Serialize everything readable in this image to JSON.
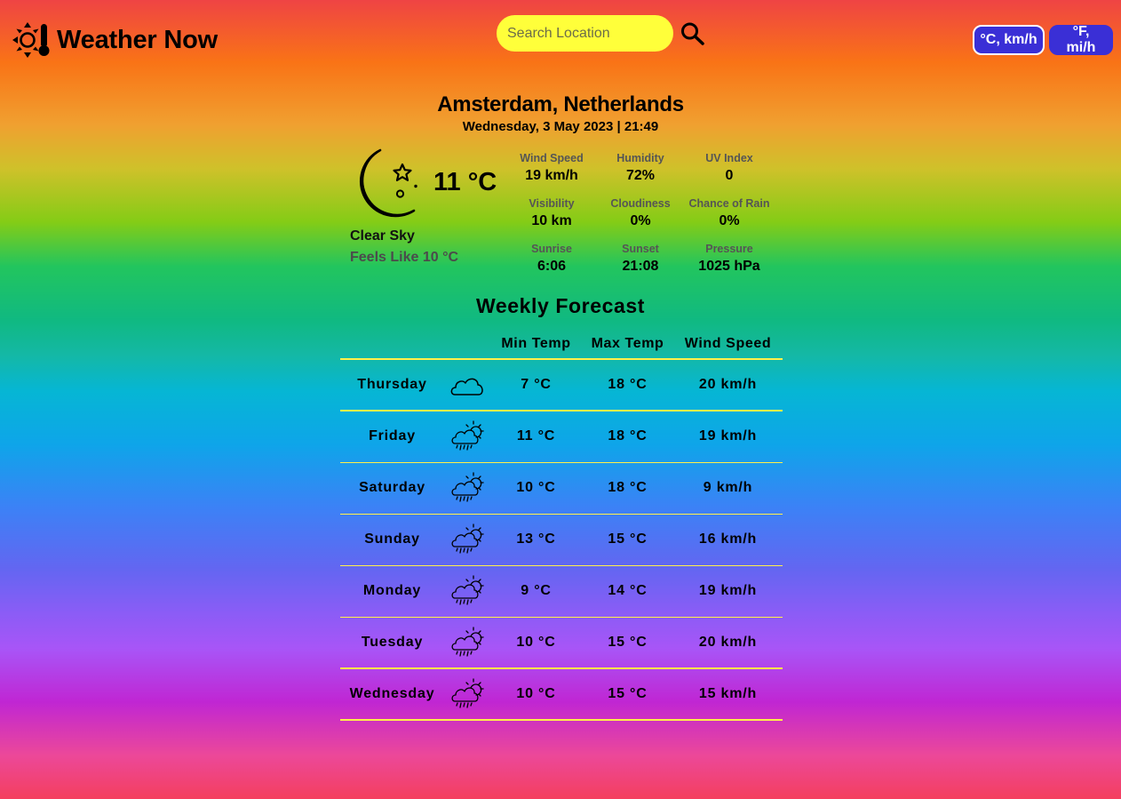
{
  "header": {
    "app_title": "Weather Now",
    "logo_icon": "sun-thermometer-icon",
    "search_placeholder": "Search Location",
    "search_icon": "magnifier-icon",
    "unit_metric_label": "°C, km/h",
    "unit_imperial_label": "°F, mi/h"
  },
  "current": {
    "location": "Amsterdam, Netherlands",
    "datetime": "Wednesday, 3 May 2023 | 21:49",
    "icon": "moon-stars-icon",
    "temperature": "11 °C",
    "condition": "Clear Sky",
    "feels_like": "Feels Like 10 °C",
    "details": [
      {
        "label": "Wind Speed",
        "value": "19 km/h"
      },
      {
        "label": "Humidity",
        "value": "72%"
      },
      {
        "label": "UV Index",
        "value": "0"
      },
      {
        "label": "Visibility",
        "value": "10 km"
      },
      {
        "label": "Cloudiness",
        "value": "0%"
      },
      {
        "label": "Chance of Rain",
        "value": "0%"
      },
      {
        "label": "Sunrise",
        "value": "6:06"
      },
      {
        "label": "Sunset",
        "value": "21:08"
      },
      {
        "label": "Pressure",
        "value": "1025 hPa"
      }
    ]
  },
  "forecast": {
    "title": "Weekly Forecast",
    "columns": [
      "Min Temp",
      "Max Temp",
      "Wind Speed"
    ],
    "days": [
      {
        "day": "Thursday",
        "icon": "cloud-icon",
        "min": "7 °C",
        "max": "18 °C",
        "wind": "20 km/h"
      },
      {
        "day": "Friday",
        "icon": "sun-cloud-rain-icon",
        "min": "11 °C",
        "max": "18 °C",
        "wind": "19 km/h"
      },
      {
        "day": "Saturday",
        "icon": "sun-cloud-rain-icon",
        "min": "10 °C",
        "max": "18 °C",
        "wind": "9 km/h"
      },
      {
        "day": "Sunday",
        "icon": "sun-cloud-rain-icon",
        "min": "13 °C",
        "max": "15 °C",
        "wind": "16 km/h"
      },
      {
        "day": "Monday",
        "icon": "sun-cloud-rain-icon",
        "min": "9 °C",
        "max": "14 °C",
        "wind": "19 km/h"
      },
      {
        "day": "Tuesday",
        "icon": "sun-cloud-rain-icon",
        "min": "10 °C",
        "max": "15 °C",
        "wind": "20 km/h"
      },
      {
        "day": "Wednesday",
        "icon": "sun-cloud-rain-icon",
        "min": "10 °C",
        "max": "15 °C",
        "wind": "15 km/h"
      }
    ]
  }
}
